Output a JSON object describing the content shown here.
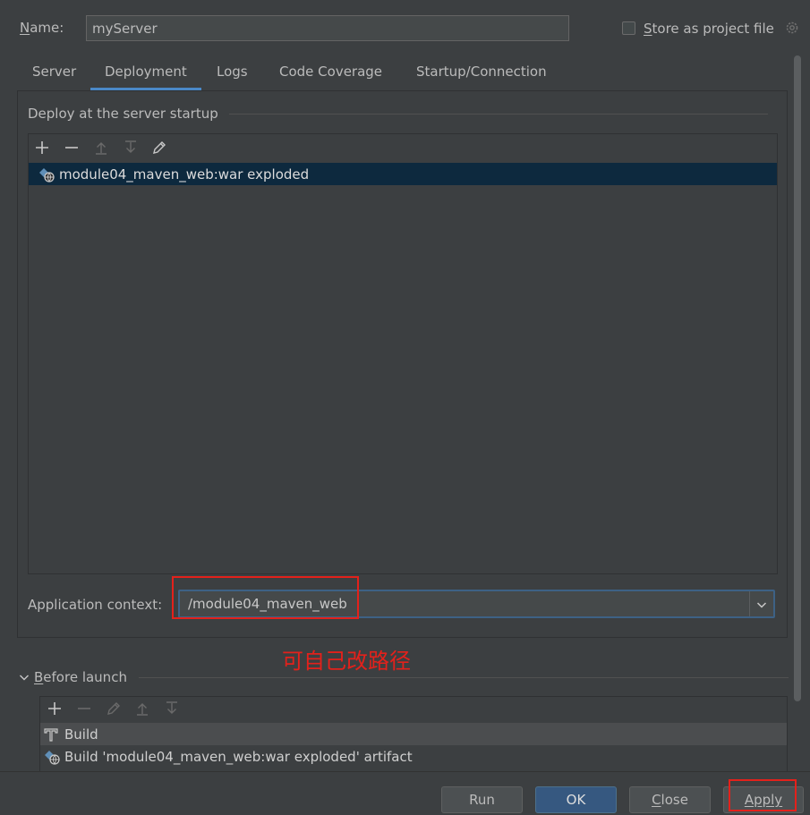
{
  "header": {
    "name_label": "Name:",
    "name_value": "myServer",
    "store_label": "Store as project file",
    "store_checked": false
  },
  "tabs": [
    {
      "label": "Server"
    },
    {
      "label": "Deployment",
      "active": true
    },
    {
      "label": "Logs"
    },
    {
      "label": "Code Coverage"
    },
    {
      "label": "Startup/Connection"
    }
  ],
  "deployment": {
    "section_title": "Deploy at the server startup",
    "toolbar": [
      "add-icon",
      "remove-icon",
      "move-up-icon",
      "move-down-icon",
      "edit-icon"
    ],
    "items": [
      {
        "label": "module04_maven_web:war exploded",
        "icon": "artifact-web-icon",
        "selected": true
      }
    ],
    "context_label": "Application context:",
    "context_value": "/module04_maven_web"
  },
  "annotation": "可自己改路径",
  "before_launch": {
    "title": "Before launch",
    "toolbar": [
      "add-icon",
      "remove-icon",
      "edit-icon",
      "move-up-icon",
      "move-down-icon"
    ],
    "items": [
      {
        "label": "Build",
        "icon": "build-icon"
      },
      {
        "label": "Build 'module04_maven_web:war exploded' artifact",
        "icon": "artifact-web-icon"
      }
    ]
  },
  "buttons": {
    "run": "Run",
    "ok": "OK",
    "close": "Close",
    "apply": "Apply"
  },
  "colors": {
    "background": "#3c3f41",
    "selection": "#0d293e",
    "tab_underline": "#4a88c7",
    "primary_button": "#365880",
    "annotation_red": "#e3211b"
  }
}
